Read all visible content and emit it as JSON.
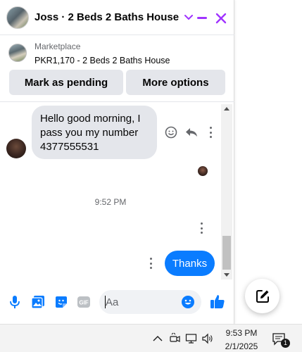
{
  "header": {
    "title": "Joss · 2 Beds 2 Baths House",
    "accent_color": "#a033ff",
    "icons": [
      "avatar",
      "chevron-down-icon",
      "minimize-icon",
      "close-icon"
    ]
  },
  "listing": {
    "source": "Marketplace",
    "item": "PKR1,170 - 2 Beds 2 Baths House",
    "buttons": {
      "pending": "Mark as pending",
      "more": "More options"
    }
  },
  "thread": {
    "incoming": "Hello good morning, I pass you my number 4377555531",
    "timestamp": "9:52 PM",
    "outgoing": "Thanks",
    "outgoing_color": "#0a7cff"
  },
  "composer": {
    "placeholder": "Aa",
    "icons": [
      "mic-icon",
      "photo-icon",
      "sticker-icon",
      "gif-icon",
      "emoji-icon",
      "thumbs-up-icon"
    ]
  },
  "taskbar": {
    "time": "9:53 PM",
    "date": "2/1/2025",
    "notification_count": "1"
  }
}
